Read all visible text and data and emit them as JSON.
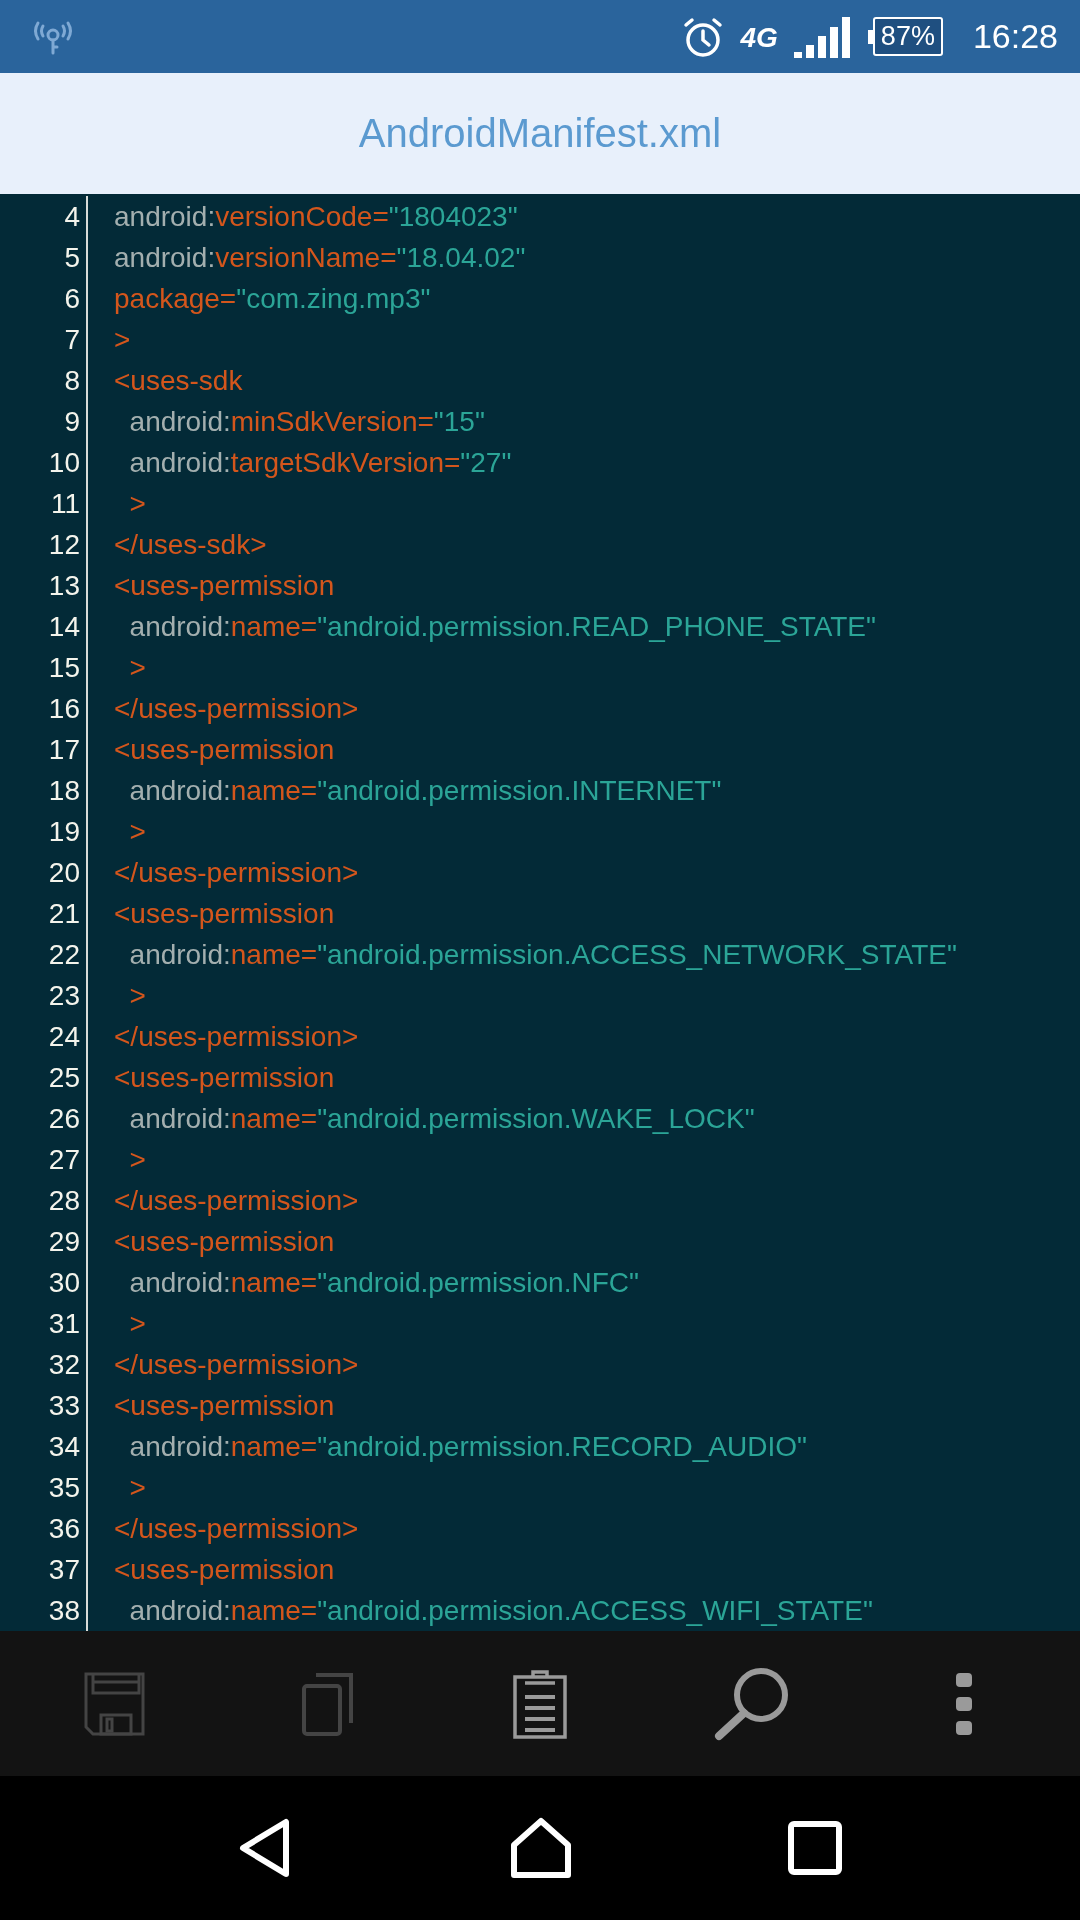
{
  "status_bar": {
    "network": "4G",
    "battery": "87%",
    "time": "16:28"
  },
  "title": "AndroidManifest.xml",
  "lines": [
    {
      "number": "4",
      "tokens": [
        {
          "kind": "prefix",
          "text": "android:"
        },
        {
          "kind": "markup",
          "text": "versionCode="
        },
        {
          "kind": "string",
          "text": "\"1804023\""
        }
      ]
    },
    {
      "number": "5",
      "tokens": [
        {
          "kind": "prefix",
          "text": "android:"
        },
        {
          "kind": "markup",
          "text": "versionName="
        },
        {
          "kind": "string",
          "text": "\"18.04.02\""
        }
      ]
    },
    {
      "number": "6",
      "tokens": [
        {
          "kind": "markup",
          "text": "package="
        },
        {
          "kind": "string",
          "text": "\"com.zing.mp3\""
        }
      ]
    },
    {
      "number": "7",
      "tokens": [
        {
          "kind": "markup",
          "text": ">"
        }
      ]
    },
    {
      "number": "8",
      "tokens": [
        {
          "kind": "markup",
          "text": "<uses-sdk"
        }
      ]
    },
    {
      "number": "9",
      "tokens": [
        {
          "kind": "prefix",
          "text": "  android:"
        },
        {
          "kind": "markup",
          "text": "minSdkVersion="
        },
        {
          "kind": "string",
          "text": "\"15\""
        }
      ]
    },
    {
      "number": "10",
      "tokens": [
        {
          "kind": "prefix",
          "text": "  android:"
        },
        {
          "kind": "markup",
          "text": "targetSdkVersion="
        },
        {
          "kind": "string",
          "text": "\"27\""
        }
      ]
    },
    {
      "number": "11",
      "tokens": [
        {
          "kind": "markup",
          "text": "  >"
        }
      ]
    },
    {
      "number": "12",
      "tokens": [
        {
          "kind": "markup",
          "text": "</uses-sdk>"
        }
      ]
    },
    {
      "number": "13",
      "tokens": [
        {
          "kind": "markup",
          "text": "<uses-permission"
        }
      ]
    },
    {
      "number": "14",
      "tokens": [
        {
          "kind": "prefix",
          "text": "  android:"
        },
        {
          "kind": "markup",
          "text": "name="
        },
        {
          "kind": "string",
          "text": "\"android.permission.READ_PHONE_STATE\""
        }
      ]
    },
    {
      "number": "15",
      "tokens": [
        {
          "kind": "markup",
          "text": "  >"
        }
      ]
    },
    {
      "number": "16",
      "tokens": [
        {
          "kind": "markup",
          "text": "</uses-permission>"
        }
      ]
    },
    {
      "number": "17",
      "tokens": [
        {
          "kind": "markup",
          "text": "<uses-permission"
        }
      ]
    },
    {
      "number": "18",
      "tokens": [
        {
          "kind": "prefix",
          "text": "  android:"
        },
        {
          "kind": "markup",
          "text": "name="
        },
        {
          "kind": "string",
          "text": "\"android.permission.INTERNET\""
        }
      ]
    },
    {
      "number": "19",
      "tokens": [
        {
          "kind": "markup",
          "text": "  >"
        }
      ]
    },
    {
      "number": "20",
      "tokens": [
        {
          "kind": "markup",
          "text": "</uses-permission>"
        }
      ]
    },
    {
      "number": "21",
      "tokens": [
        {
          "kind": "markup",
          "text": "<uses-permission"
        }
      ]
    },
    {
      "number": "22",
      "tokens": [
        {
          "kind": "prefix",
          "text": "  android:"
        },
        {
          "kind": "markup",
          "text": "name="
        },
        {
          "kind": "string",
          "text": "\"android.permission.ACCESS_NETWORK_STATE\""
        }
      ]
    },
    {
      "number": "23",
      "tokens": [
        {
          "kind": "markup",
          "text": "  >"
        }
      ]
    },
    {
      "number": "24",
      "tokens": [
        {
          "kind": "markup",
          "text": "</uses-permission>"
        }
      ]
    },
    {
      "number": "25",
      "tokens": [
        {
          "kind": "markup",
          "text": "<uses-permission"
        }
      ]
    },
    {
      "number": "26",
      "tokens": [
        {
          "kind": "prefix",
          "text": "  android:"
        },
        {
          "kind": "markup",
          "text": "name="
        },
        {
          "kind": "string",
          "text": "\"android.permission.WAKE_LOCK\""
        }
      ]
    },
    {
      "number": "27",
      "tokens": [
        {
          "kind": "markup",
          "text": "  >"
        }
      ]
    },
    {
      "number": "28",
      "tokens": [
        {
          "kind": "markup",
          "text": "</uses-permission>"
        }
      ]
    },
    {
      "number": "29",
      "tokens": [
        {
          "kind": "markup",
          "text": "<uses-permission"
        }
      ]
    },
    {
      "number": "30",
      "tokens": [
        {
          "kind": "prefix",
          "text": "  android:"
        },
        {
          "kind": "markup",
          "text": "name="
        },
        {
          "kind": "string",
          "text": "\"android.permission.NFC\""
        }
      ]
    },
    {
      "number": "31",
      "tokens": [
        {
          "kind": "markup",
          "text": "  >"
        }
      ]
    },
    {
      "number": "32",
      "tokens": [
        {
          "kind": "markup",
          "text": "</uses-permission>"
        }
      ]
    },
    {
      "number": "33",
      "tokens": [
        {
          "kind": "markup",
          "text": "<uses-permission"
        }
      ]
    },
    {
      "number": "34",
      "tokens": [
        {
          "kind": "prefix",
          "text": "  android:"
        },
        {
          "kind": "markup",
          "text": "name="
        },
        {
          "kind": "string",
          "text": "\"android.permission.RECORD_AUDIO\""
        }
      ]
    },
    {
      "number": "35",
      "tokens": [
        {
          "kind": "markup",
          "text": "  >"
        }
      ]
    },
    {
      "number": "36",
      "tokens": [
        {
          "kind": "markup",
          "text": "</uses-permission>"
        }
      ]
    },
    {
      "number": "37",
      "tokens": [
        {
          "kind": "markup",
          "text": "<uses-permission"
        }
      ]
    },
    {
      "number": "38",
      "tokens": [
        {
          "kind": "prefix",
          "text": "  android:"
        },
        {
          "kind": "markup",
          "text": "name="
        },
        {
          "kind": "string",
          "text": "\"android.permission.ACCESS_WIFI_STATE\""
        }
      ]
    }
  ],
  "toolbar": [
    {
      "kind": "save",
      "disabled": true
    },
    {
      "kind": "copy",
      "disabled": true
    },
    {
      "kind": "paste",
      "disabled": false
    },
    {
      "kind": "search",
      "disabled": false
    },
    {
      "kind": "more",
      "disabled": false
    }
  ]
}
